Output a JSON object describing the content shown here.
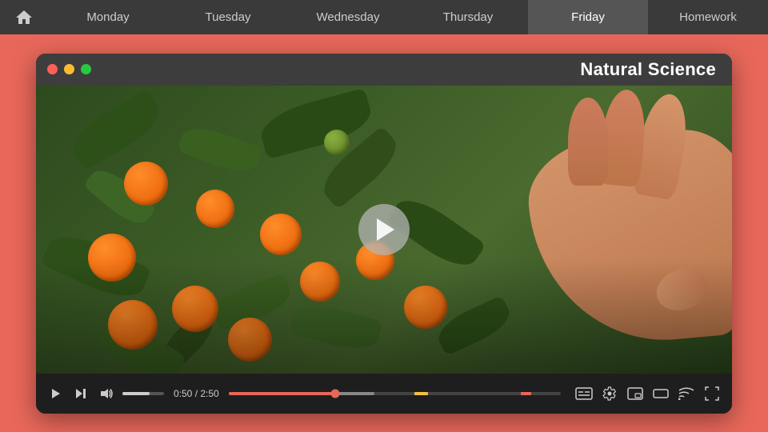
{
  "nav": {
    "home_icon": "🏠",
    "tabs": [
      {
        "id": "monday",
        "label": "Monday",
        "active": false
      },
      {
        "id": "tuesday",
        "label": "Tuesday",
        "active": false
      },
      {
        "id": "wednesday",
        "label": "Wednesday",
        "active": false
      },
      {
        "id": "thursday",
        "label": "Thursday",
        "active": false
      },
      {
        "id": "friday",
        "label": "Friday",
        "active": true
      },
      {
        "id": "homework",
        "label": "Homework",
        "active": false
      }
    ]
  },
  "video_player": {
    "window_title": "Natural Science",
    "play_label": "▶",
    "skip_label": "⏭",
    "volume_label": "🔊",
    "time_current": "0:50",
    "time_total": "2:50",
    "time_display": "0:50 / 2:50",
    "progress_percent": 32,
    "controls": {
      "captions_label": "CC",
      "settings_label": "⚙",
      "pip_label": "⧉",
      "theater_label": "▭",
      "cast_label": "⊡",
      "fullscreen_label": "⛶"
    }
  }
}
